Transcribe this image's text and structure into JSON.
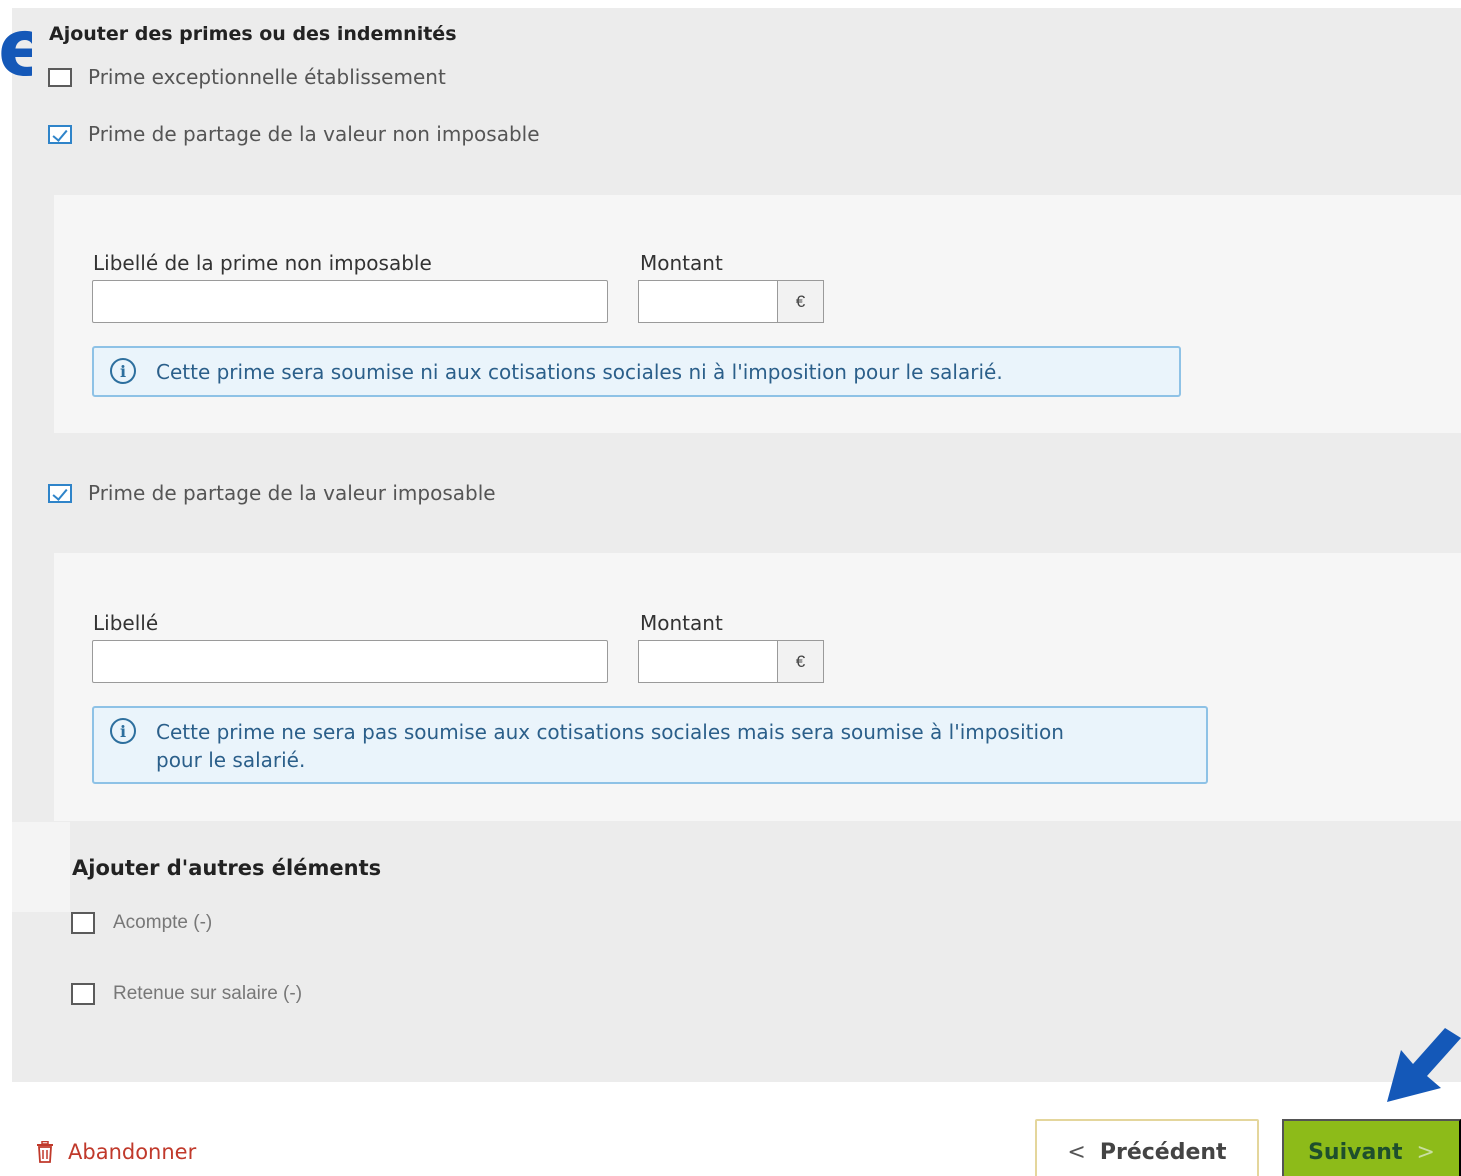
{
  "corner_letter": "e",
  "section_primes": {
    "title": "Ajouter des primes ou des indemnités",
    "options": [
      {
        "label": "Prime exceptionnelle établissement",
        "checked": false
      },
      {
        "label": "Prime de partage de la valeur non imposable",
        "checked": true
      },
      {
        "label": "Prime de partage de la valeur imposable",
        "checked": true
      }
    ]
  },
  "non_imposable": {
    "label_field": "Libellé de la prime non imposable",
    "label_value": "",
    "amount_label": "Montant",
    "amount_value": "",
    "currency": "€",
    "info": "Cette prime sera soumise ni aux cotisations sociales ni à l'imposition pour le salarié."
  },
  "imposable": {
    "label_field": "Libellé",
    "label_value": "",
    "amount_label": "Montant",
    "amount_value": "",
    "currency": "€",
    "info": "Cette prime ne sera pas soumise aux cotisations sociales mais sera soumise à l'imposition pour le salarié."
  },
  "section_autres": {
    "title": "Ajouter d'autres éléments",
    "options": [
      {
        "label": "Acompte (-)",
        "checked": false
      },
      {
        "label": "Retenue sur salaire (-)",
        "checked": false
      }
    ]
  },
  "footer": {
    "abandon": "Abandonner",
    "previous": "Précédent",
    "next": "Suivant"
  },
  "colors": {
    "accent_blue": "#2f84c9",
    "next_button": "#8dbb19",
    "abandon_red": "#c0392b",
    "pointer_arrow": "#1458b8"
  },
  "icons": {
    "info": "info-circle-icon",
    "trash": "trash-icon",
    "prev": "chevron-left-icon",
    "next": "chevron-right-icon",
    "pointer": "pointer-arrow-icon"
  }
}
